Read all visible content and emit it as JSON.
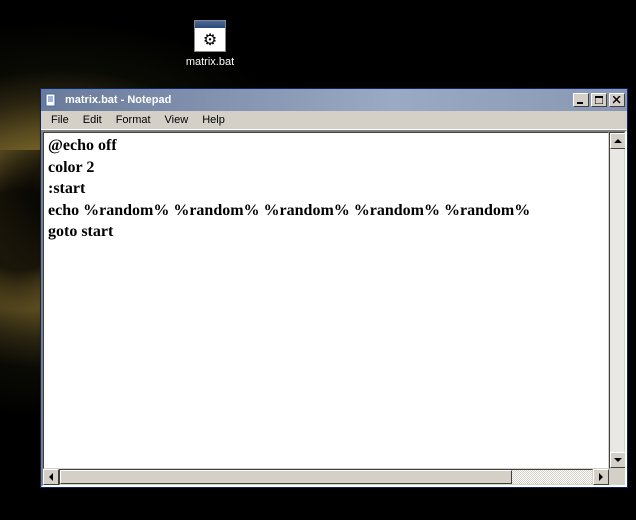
{
  "desktop": {
    "icon_label": "matrix.bat"
  },
  "window": {
    "title": "matrix.bat - Notepad",
    "menu": {
      "file": "File",
      "edit": "Edit",
      "format": "Format",
      "view": "View",
      "help": "Help"
    },
    "content": "@echo off\ncolor 2\n:start\necho %random% %random% %random% %random% %random%\ngoto start"
  }
}
